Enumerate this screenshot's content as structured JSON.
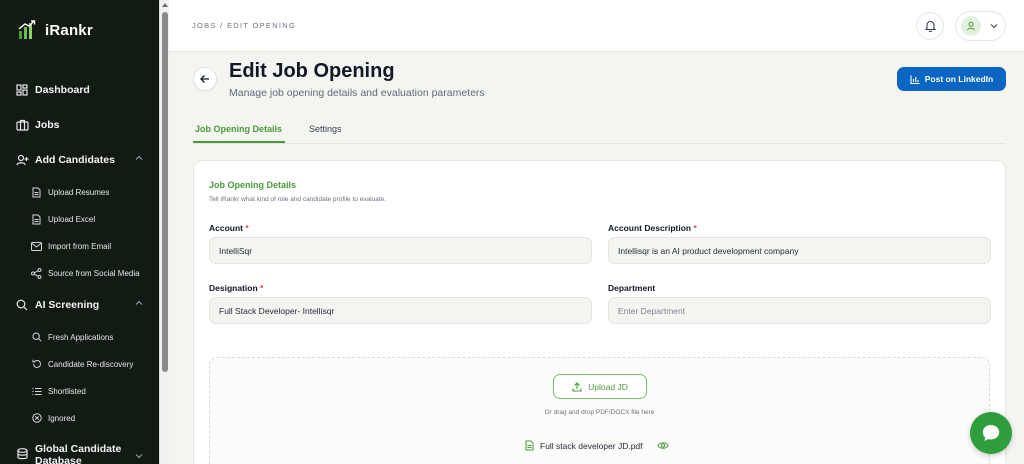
{
  "app": {
    "name": "iRankr"
  },
  "sidebar": {
    "items": [
      {
        "label": "Dashboard",
        "icon": "dashboard-icon"
      },
      {
        "label": "Jobs",
        "icon": "briefcase-icon"
      },
      {
        "label": "Add Candidates",
        "icon": "user-plus-icon",
        "expanded": true
      },
      {
        "label": "Upload Resumes",
        "icon": "file-icon"
      },
      {
        "label": "Upload Excel",
        "icon": "file-icon"
      },
      {
        "label": "Import from Email",
        "icon": "mail-icon"
      },
      {
        "label": "Source from Social Media",
        "icon": "share-icon"
      },
      {
        "label": "AI Screening",
        "icon": "search-icon",
        "expanded": true
      },
      {
        "label": "Fresh Applications",
        "icon": "search-icon"
      },
      {
        "label": "Candidate Re-discovery",
        "icon": "refresh-icon"
      },
      {
        "label": "Shortlisted",
        "icon": "list-icon"
      },
      {
        "label": "Ignored",
        "icon": "ignored-icon"
      },
      {
        "label": "Global Candidate Database",
        "icon": "database-icon",
        "expanded": false
      }
    ]
  },
  "header": {
    "breadcrumb": "JOBS / EDIT OPENING"
  },
  "page": {
    "title": "Edit Job Opening",
    "subtitle": "Manage job opening details and evaluation parameters",
    "linkedin_label": "Post on LinkedIn"
  },
  "tabs": [
    {
      "label": "Job Opening Details",
      "active": true
    },
    {
      "label": "Settings",
      "active": false
    }
  ],
  "form": {
    "section_title": "Job Opening Details",
    "section_desc": "Tell iRankr what kind of role and candidate profile to evaluate.",
    "account": {
      "label": "Account",
      "required_mark": "*",
      "value": "IntelliSqr"
    },
    "account_description": {
      "label": "Account Description",
      "required_mark": "*",
      "value": "Intellisqr is an AI product development company"
    },
    "designation": {
      "label": "Designation",
      "required_mark": "*",
      "value": "Full Stack Developer- Intellisqr"
    },
    "department": {
      "label": "Department",
      "value": "",
      "placeholder": "Enter Department"
    },
    "upload": {
      "button_label": "Upload JD",
      "hint": "Or drag and drop PDF/DOCX file here",
      "file_name": "Full stack developer JD.pdf"
    }
  },
  "colors": {
    "accent_green": "#4a9b3a",
    "sidebar_bg": "#121a14",
    "linkedin_blue": "#0a66c2",
    "required_red": "#e04848",
    "chat_green": "#2f9e3d"
  }
}
